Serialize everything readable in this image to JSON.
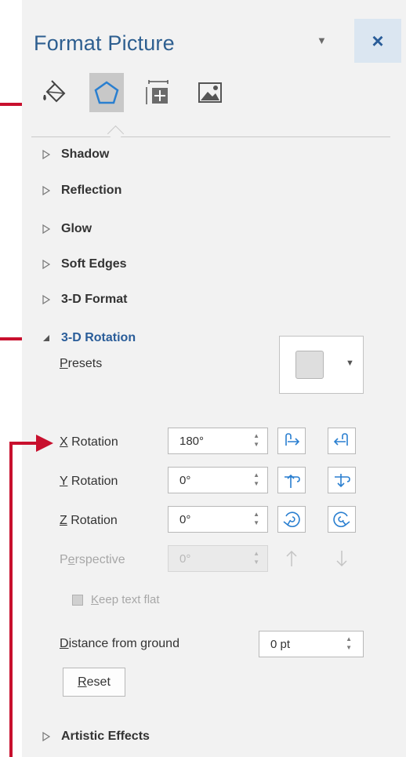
{
  "panel": {
    "title": "Format Picture",
    "close_label": "×",
    "tabs": [
      {
        "icon": "fill-line-icon",
        "active": false
      },
      {
        "icon": "effects-pentagon-icon",
        "active": true
      },
      {
        "icon": "size-properties-icon",
        "active": false
      },
      {
        "icon": "picture-icon",
        "active": false
      }
    ]
  },
  "sections": {
    "shadow": "Shadow",
    "reflection": "Reflection",
    "glow": "Glow",
    "soft_edges": "Soft Edges",
    "format_3d": "3-D Format",
    "rotation_3d": "3-D Rotation",
    "artistic_effects": "Artistic Effects"
  },
  "rotation": {
    "presets": {
      "u": "P",
      "rest": "resets"
    },
    "x": {
      "u": "X",
      "rest": " Rotation",
      "value": "180°"
    },
    "y": {
      "u": "Y",
      "rest": " Rotation",
      "value": "0°"
    },
    "z": {
      "u": "Z",
      "rest": " Rotation",
      "value": "0°"
    },
    "perspective": {
      "a": "P",
      "u": "e",
      "rest": "rspective",
      "value": "0°"
    },
    "keep_flat": {
      "u": "K",
      "rest": "eep text flat"
    },
    "distance": {
      "u": "D",
      "rest": "istance from ground",
      "value": "0 pt"
    },
    "reset": {
      "u": "R",
      "rest": "eset"
    }
  },
  "colors": {
    "accent": "#2a5d99",
    "title": "#2e5f90",
    "callout_arrow": "#c8102e",
    "panel_bg": "#f2f2f2"
  }
}
